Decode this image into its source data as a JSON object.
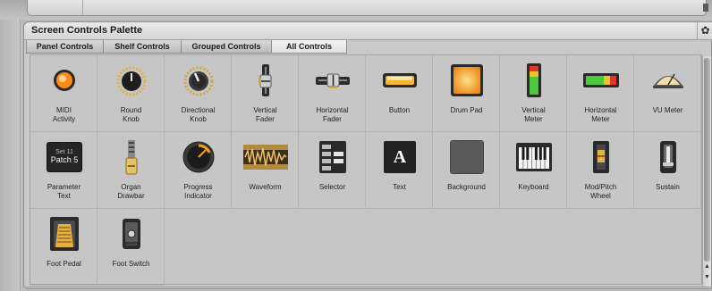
{
  "window": {
    "title": "Screen Controls Palette",
    "gear_icon": "gear-icon"
  },
  "tabs": [
    {
      "label": "Panel Controls",
      "active": false
    },
    {
      "label": "Shelf Controls",
      "active": false
    },
    {
      "label": "Grouped Controls",
      "active": false
    },
    {
      "label": "All Controls",
      "active": true
    }
  ],
  "controls": [
    {
      "icon": "midi-activity-icon",
      "label1": "MIDI",
      "label2": "Activity"
    },
    {
      "icon": "round-knob-icon",
      "label1": "Round",
      "label2": "Knob"
    },
    {
      "icon": "directional-knob-icon",
      "label1": "Directional",
      "label2": "Knob"
    },
    {
      "icon": "vertical-fader-icon",
      "label1": "Vertical",
      "label2": "Fader"
    },
    {
      "icon": "horizontal-fader-icon",
      "label1": "Horizontal",
      "label2": "Fader"
    },
    {
      "icon": "button-icon",
      "label1": "Button",
      "label2": ""
    },
    {
      "icon": "drum-pad-icon",
      "label1": "Drum Pad",
      "label2": ""
    },
    {
      "icon": "vertical-meter-icon",
      "label1": "Vertical",
      "label2": "Meter"
    },
    {
      "icon": "horizontal-meter-icon",
      "label1": "Horizontal",
      "label2": "Meter"
    },
    {
      "icon": "vu-meter-icon",
      "label1": "VU Meter",
      "label2": ""
    },
    {
      "icon": "parameter-text-icon",
      "label1": "Parameter",
      "label2": "Text",
      "preview_line1": "Set 11",
      "preview_line2": "Patch 5"
    },
    {
      "icon": "organ-drawbar-icon",
      "label1": "Organ",
      "label2": "Drawbar"
    },
    {
      "icon": "progress-indicator-icon",
      "label1": "Progress",
      "label2": "Indicator"
    },
    {
      "icon": "waveform-icon",
      "label1": "Waveform",
      "label2": ""
    },
    {
      "icon": "selector-icon",
      "label1": "Selector",
      "label2": ""
    },
    {
      "icon": "text-icon",
      "label1": "Text",
      "label2": "",
      "preview_letter": "A"
    },
    {
      "icon": "background-icon",
      "label1": "Background",
      "label2": ""
    },
    {
      "icon": "keyboard-icon",
      "label1": "Keyboard",
      "label2": ""
    },
    {
      "icon": "mod-pitch-wheel-icon",
      "label1": "Mod/Pitch",
      "label2": "Wheel"
    },
    {
      "icon": "sustain-icon",
      "label1": "Sustain",
      "label2": ""
    },
    {
      "icon": "foot-pedal-icon",
      "label1": "Foot Pedal",
      "label2": ""
    },
    {
      "icon": "foot-switch-icon",
      "label1": "Foot Switch",
      "label2": ""
    }
  ]
}
